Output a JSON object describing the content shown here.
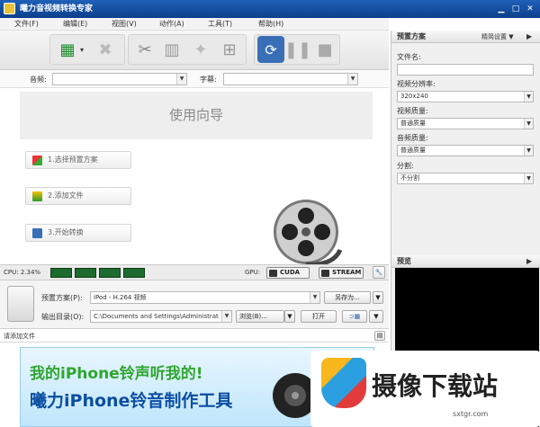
{
  "window": {
    "title": "曦力音视频转换专家"
  },
  "menu": [
    "文件(F)",
    "编辑(E)",
    "视图(V)",
    "动作(A)",
    "工具(T)",
    "帮助(H)"
  ],
  "filters": {
    "audio_label": "音频:",
    "audio_value": "",
    "subtitle_label": "字幕:",
    "subtitle_value": ""
  },
  "wizard": {
    "title": "使用向导",
    "steps": [
      "1.选择预置方案",
      "2.添加文件",
      "3.开始转换"
    ]
  },
  "status": {
    "cpu_label": "CPU: 2.34%",
    "gpu_label": "GPU:",
    "cuda": "CUDA",
    "amd": "STREAM"
  },
  "options": {
    "preset_label": "预置方案(P):",
    "preset_value": "iPod - H.264 视频",
    "save_as": "另存为...",
    "output_label": "输出目录(O):",
    "output_value": "C:\\Documents and Settings\\Administrat",
    "browse": "浏览(B)...",
    "open": "打开"
  },
  "add_file_hint": "请添加文件",
  "banner": {
    "line1": "我的iPhone铃声听我的!",
    "line2": "曦力iPhone铃音制作工具"
  },
  "right_panel": {
    "title": "预置方案",
    "settings": "精简设置 ▼",
    "filename_label": "文件名:",
    "filename_value": "",
    "resolution_label": "视频分辨率:",
    "resolution_value": "320x240",
    "video_quality_label": "视频质量:",
    "video_quality_value": "普通质量",
    "audio_quality_label": "音频质量:",
    "audio_quality_value": "普通质量",
    "split_label": "分割:",
    "split_value": "不分割",
    "preview_title": "预览"
  },
  "watermark": {
    "text": "摄像下载站",
    "url": "sxtgr.com"
  }
}
